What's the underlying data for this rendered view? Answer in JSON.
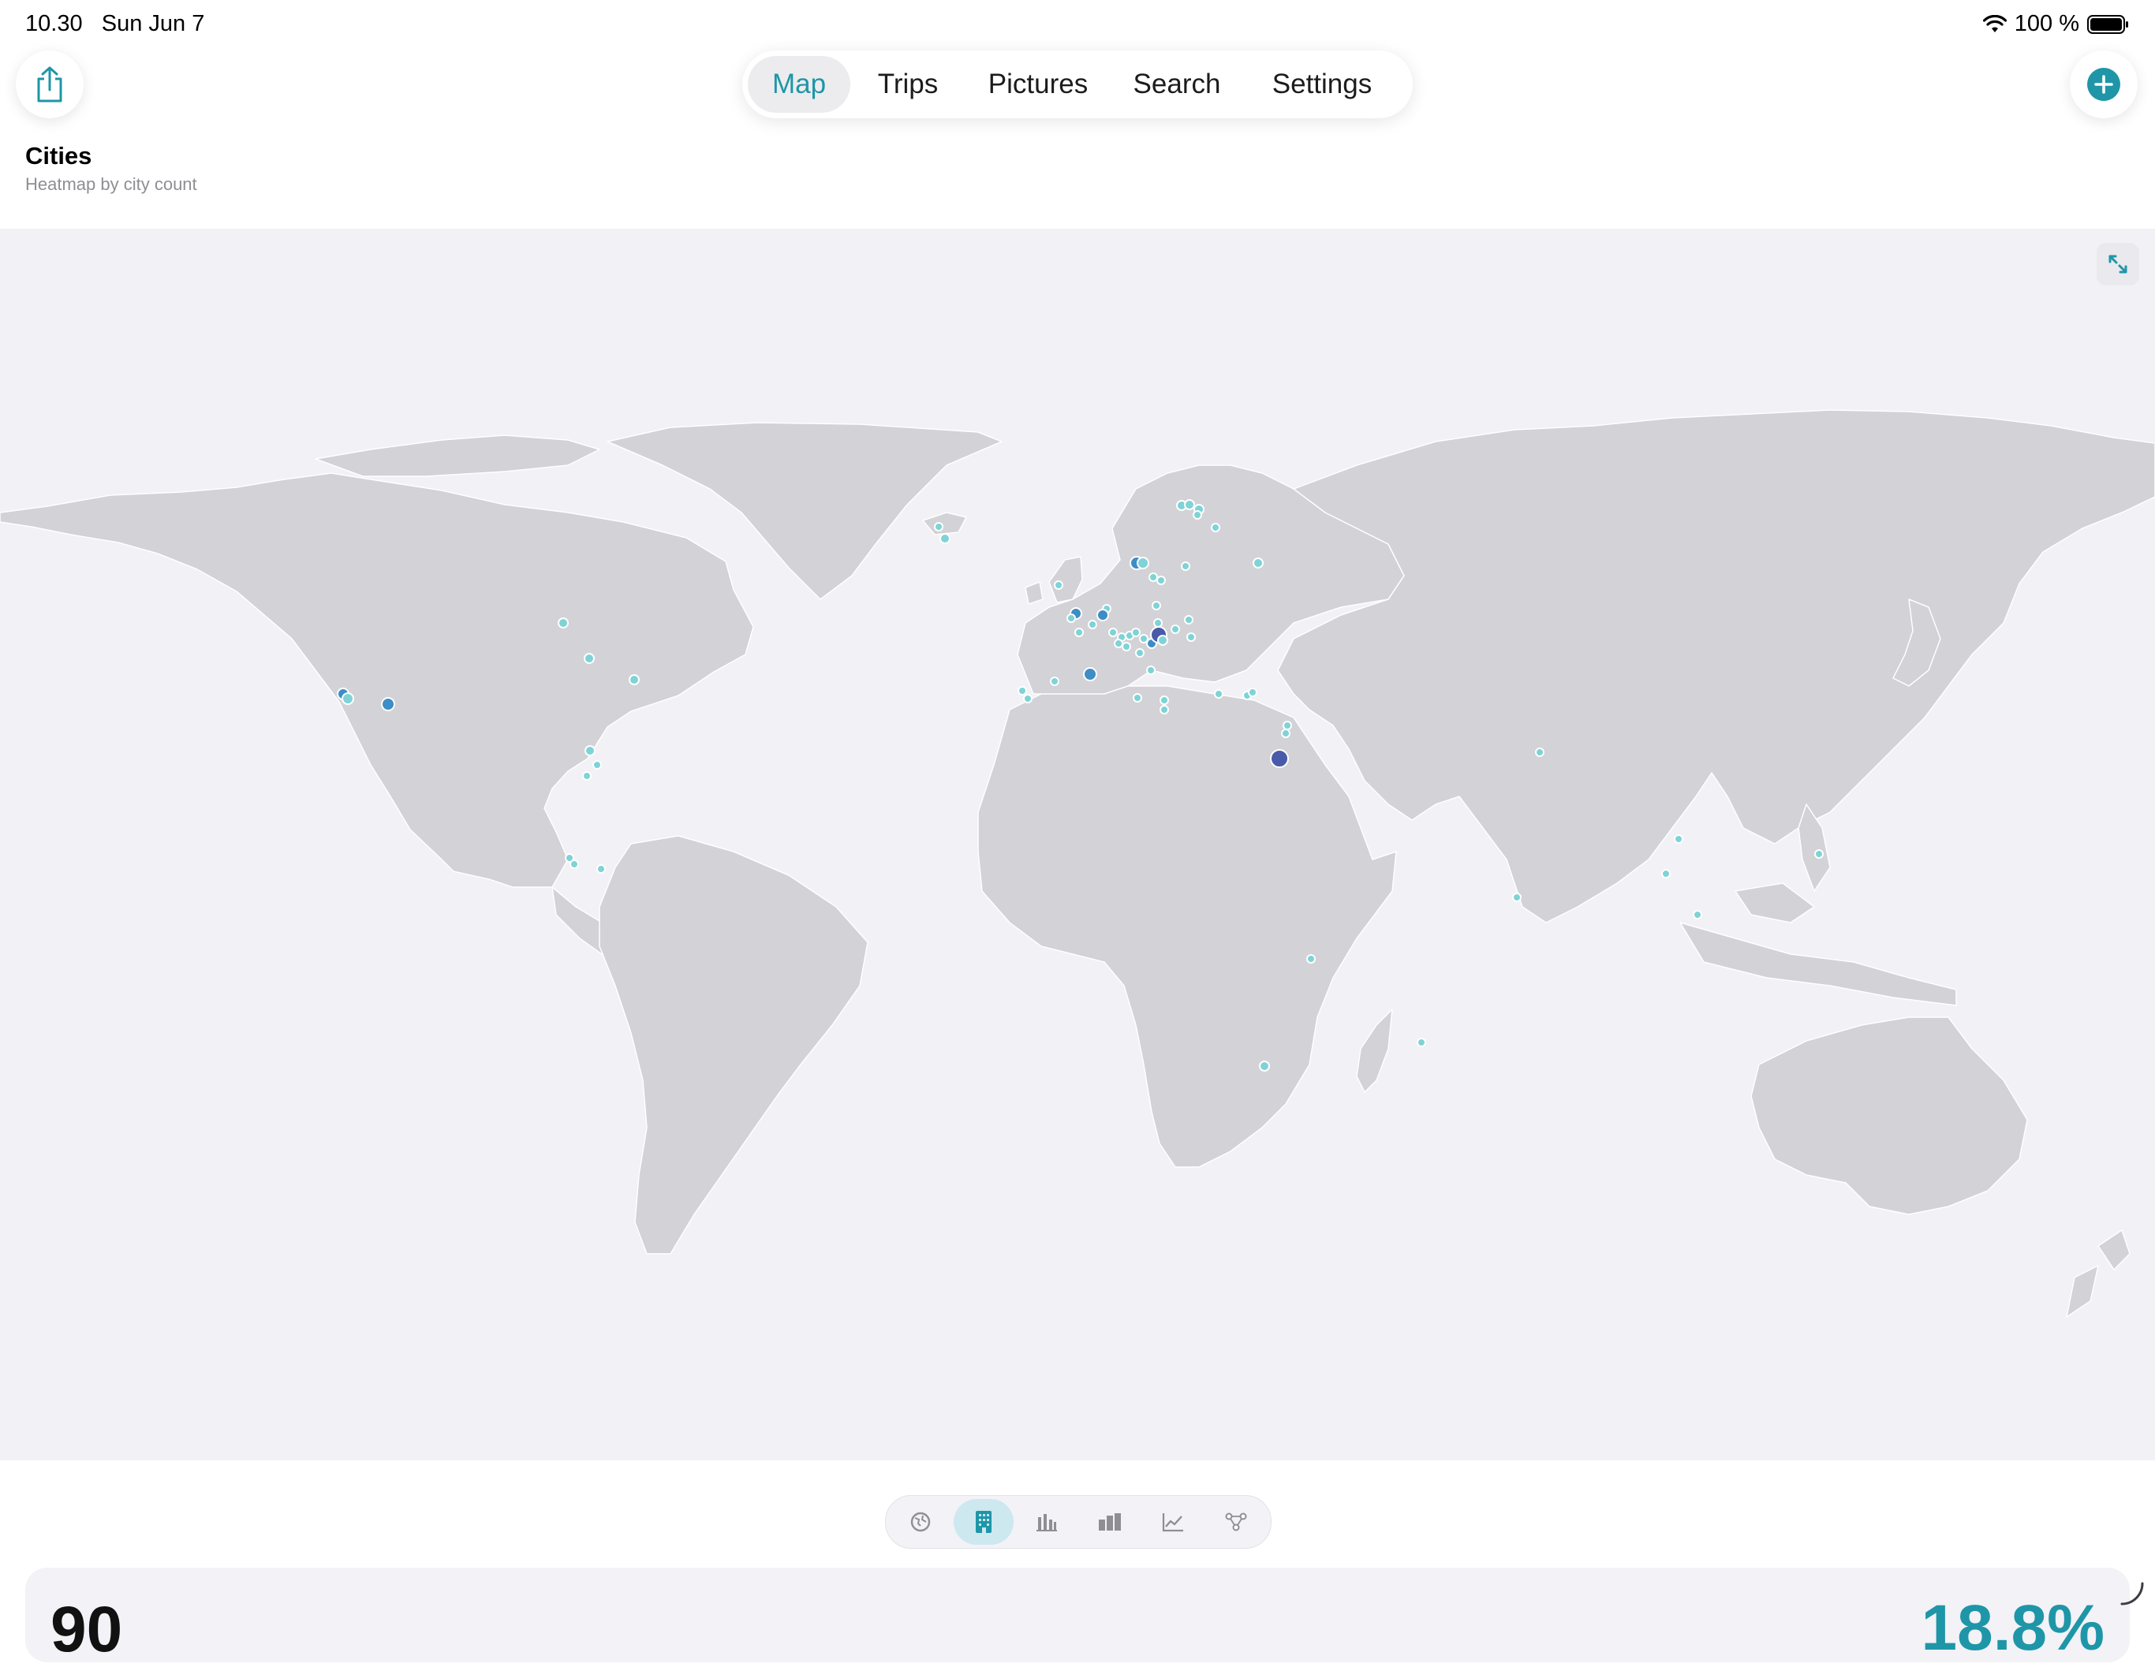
{
  "status_bar": {
    "time": "10.30",
    "date": "Sun Jun 7",
    "battery": "100 %",
    "icons": [
      "wifi-icon",
      "battery-icon"
    ]
  },
  "header": {
    "share_icon": "share-icon",
    "add_icon": "plus-circle-icon",
    "tabs": [
      {
        "label": "Map",
        "active": true
      },
      {
        "label": "Trips",
        "active": false
      },
      {
        "label": "Pictures",
        "active": false
      },
      {
        "label": "Search",
        "active": false
      },
      {
        "label": "Settings",
        "active": false
      }
    ]
  },
  "section": {
    "title": "Cities",
    "subtitle": "Heatmap by city count"
  },
  "map": {
    "expand_icon": "expand-arrows-icon",
    "land_color": "#d2d2d7",
    "ocean_color": "#f1f1f6",
    "marker_colors": {
      "low": "#7fd3d6",
      "mid": "#3d8dc6",
      "high": "#4a5aaa"
    }
  },
  "view_modes": [
    {
      "icon": "globe-icon",
      "active": false
    },
    {
      "icon": "building-icon",
      "active": true
    },
    {
      "icon": "bar-chart-icon",
      "active": false
    },
    {
      "icon": "stacked-bar-icon",
      "active": false
    },
    {
      "icon": "line-chart-icon",
      "active": false
    },
    {
      "icon": "network-graph-icon",
      "active": false
    }
  ],
  "summary": {
    "count": "90",
    "percent": "18.8%"
  },
  "colors": {
    "accent": "#1e96a8",
    "text_primary": "#1c1c1e",
    "text_secondary": "#8e8e93"
  }
}
